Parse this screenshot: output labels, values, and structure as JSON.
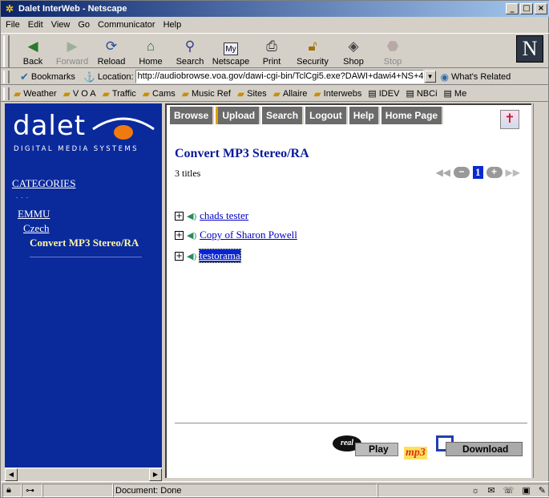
{
  "window": {
    "title": "Dalet InterWeb - Netscape"
  },
  "menu": [
    "File",
    "Edit",
    "View",
    "Go",
    "Communicator",
    "Help"
  ],
  "toolbar": {
    "buttons": [
      {
        "label": "Back",
        "icon": "back-arrow-icon",
        "enabled": true
      },
      {
        "label": "Forward",
        "icon": "forward-arrow-icon",
        "enabled": false
      },
      {
        "label": "Reload",
        "icon": "reload-icon",
        "enabled": true
      },
      {
        "label": "Home",
        "icon": "home-icon",
        "enabled": true
      },
      {
        "label": "Search",
        "icon": "search-icon",
        "enabled": true
      },
      {
        "label": "Netscape",
        "icon": "netscape-icon",
        "enabled": true
      },
      {
        "label": "Print",
        "icon": "printer-icon",
        "enabled": true
      },
      {
        "label": "Security",
        "icon": "lock-icon",
        "enabled": true
      },
      {
        "label": "Shop",
        "icon": "shop-icon",
        "enabled": true
      },
      {
        "label": "Stop",
        "icon": "stop-icon",
        "enabled": false
      }
    ],
    "logo": "N"
  },
  "location": {
    "bookmarks_label": "Bookmarks",
    "location_label": "Location:",
    "url": "http://audiobrowse.voa.gov/dawi-cgi-bin/TclCgi5.exe?DAWI+dawi4+NS+4",
    "related_label": "What's Related"
  },
  "personal_toolbar": [
    "Weather",
    "V O A",
    "Traffic",
    "Cams",
    "Music Ref",
    "Sites",
    "Allaire",
    "Interwebs",
    "IDEV",
    "NBCi",
    "Me"
  ],
  "sidebar": {
    "logo_text": "dalet",
    "logo_tagline": "DIGITAL MEDIA SYSTEMS",
    "categories_label": "CATEGORIES",
    "dots": ". . .",
    "tree": [
      {
        "label": "EMMU",
        "level": 1,
        "link": true
      },
      {
        "label": "Czech",
        "level": 2,
        "link": true
      },
      {
        "label": "Convert MP3 Stereo/RA",
        "level": 3,
        "link": false
      }
    ]
  },
  "content": {
    "nav": [
      "Browse",
      "Upload",
      "Search",
      "Logout",
      "Help",
      "Home Page"
    ],
    "title": "Convert MP3 Stereo/RA",
    "count": "3 titles",
    "page": "1",
    "items": [
      {
        "label": "chads tester",
        "selected": false
      },
      {
        "label": "Copy of Sharon Powell",
        "selected": false
      },
      {
        "label": "testorama",
        "selected": true
      }
    ],
    "real_play_label": "Play",
    "real_logo": "real",
    "mp3_label": "mp3",
    "download_label": "Download"
  },
  "status": {
    "text": "Document: Done"
  },
  "colors": {
    "sidebar_bg": "#0a2a9c",
    "title_blue": "#0a1a9c",
    "link": "#0000c0",
    "highlight": "#fff7a0",
    "nav_bg": "#6b6b6b"
  }
}
